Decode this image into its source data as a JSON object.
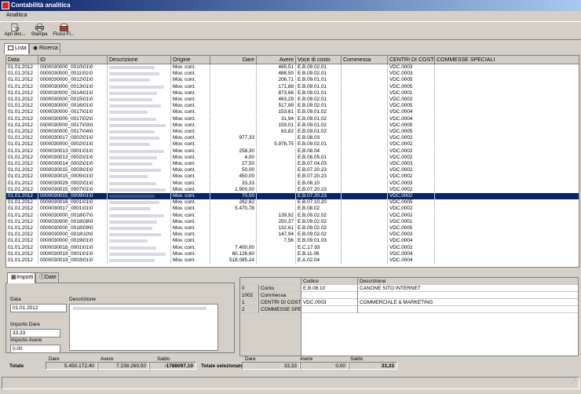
{
  "window": {
    "title": "Contabilità analitica"
  },
  "menu": {
    "items": [
      "Analitica"
    ]
  },
  "toolbar": {
    "buttons": [
      {
        "label": "Apri doc...",
        "icon": "open-document-icon"
      },
      {
        "label": "Stampa",
        "icon": "printer-icon"
      },
      {
        "label": "Flussi Fi...",
        "icon": "flows-icon"
      }
    ]
  },
  "tabs": {
    "lista": "Lista",
    "ricerca": "Ricerca"
  },
  "grid": {
    "headers": {
      "data": "Data",
      "id": "ID",
      "descrizione": "Descrizione",
      "origine": "Origine",
      "dare": "Dare",
      "avere": "Avere",
      "voce": "Voce di costo",
      "commessa": "Commessa",
      "centri": "CENTRI DI COSTO",
      "speciali": "COMMESSE SPECIALI"
    },
    "selected_index": 20,
    "rows": [
      {
        "data": "01.01.2012",
        "id": "0000030000_0010\\01\\0",
        "origine": "Mov. cont.",
        "dare": "",
        "avere": "465,51",
        "voce": "E.B.09.02.01",
        "centri": "VDC.0003"
      },
      {
        "data": "01.01.2012",
        "id": "0000030000_0011\\01\\0",
        "origine": "Mov. cont.",
        "dare": "",
        "avere": "488,50",
        "voce": "E.B.09.02.01",
        "centri": "VDC.0003"
      },
      {
        "data": "01.01.2012",
        "id": "0000030000_0012\\01\\0",
        "origine": "Mov. cont.",
        "dare": "",
        "avere": "206,71",
        "voce": "E.B.09.01.01",
        "centri": "VDC.0005"
      },
      {
        "data": "01.01.2012",
        "id": "0000030000_0013\\01\\0",
        "origine": "Mov. cont.",
        "dare": "",
        "avere": "171,88",
        "voce": "E.B.09.01.01",
        "centri": "VDC.0005"
      },
      {
        "data": "01.01.2012",
        "id": "0000030000_0014\\01\\0",
        "origine": "Mov. cont.",
        "dare": "",
        "avere": "873,66",
        "voce": "E.B.09.01.01",
        "centri": "VDC.0001"
      },
      {
        "data": "01.01.2012",
        "id": "0000030000_0015\\01\\0",
        "origine": "Mov. cont.",
        "dare": "",
        "avere": "463,29",
        "voce": "E.B.09.02.01",
        "centri": "VDC.0002"
      },
      {
        "data": "01.01.2012",
        "id": "0000030000_0016\\01\\0",
        "origine": "Mov. cont.",
        "dare": "",
        "avere": "517,99",
        "voce": "E.B.09.02.01",
        "centri": "VDC.0005"
      },
      {
        "data": "01.01.2012",
        "id": "0000030000_0017\\01\\0",
        "origine": "Mov. cont.",
        "dare": "",
        "avere": "153,61",
        "voce": "E.B.09.01.02",
        "centri": "VDC.0004"
      },
      {
        "data": "01.01.2012",
        "id": "0000030000_0017\\02\\0",
        "origine": "Mov. cont.",
        "dare": "",
        "avere": "31,94",
        "voce": "E.B.09.01.02",
        "centri": "VDC.0004"
      },
      {
        "data": "01.01.2012",
        "id": "0000030000_0017\\03\\0",
        "origine": "Mov. cont.",
        "dare": "",
        "avere": "159,01",
        "voce": "E.B.09.01.02",
        "centri": "VDC.0005"
      },
      {
        "data": "01.01.2012",
        "id": "0000030000_0017\\04\\0",
        "origine": "Mov. cont.",
        "dare": "",
        "avere": "63,82",
        "voce": "E.B.09.01.02",
        "centri": "VDC.0005"
      },
      {
        "data": "01.01.2012",
        "id": "0000030017_0002\\01\\0",
        "origine": "Mov. cont.",
        "dare": "977,33",
        "avere": "",
        "voce": "E.B.08.03",
        "centri": "VDC.0002"
      },
      {
        "data": "01.01.2012",
        "id": "0000030000_0002\\01\\0",
        "origine": "Mov. cont.",
        "dare": "",
        "avere": "5.978,75",
        "voce": "E.B.09.02.01",
        "centri": "VDC.0002"
      },
      {
        "data": "01.01.2012",
        "id": "0000030013_0001\\01\\0",
        "origine": "Mov. cont.",
        "dare": "258,30",
        "avere": "",
        "voce": "E.B.08.04",
        "centri": "VDC.0002"
      },
      {
        "data": "01.01.2012",
        "id": "0000030013_0002\\01\\0",
        "origine": "Mov. cont.",
        "dare": "4,00",
        "avere": "",
        "voce": "E.B.06.05.01",
        "centri": "VDC.0002"
      },
      {
        "data": "01.01.2012",
        "id": "0000030014_0002\\01\\0",
        "origine": "Mov. cont.",
        "dare": "27,50",
        "avere": "",
        "voce": "E.B.07.04.03",
        "centri": "VDC.0003"
      },
      {
        "data": "01.01.2012",
        "id": "0000030015_0003\\01\\0",
        "origine": "Mov. cont.",
        "dare": "50,00",
        "avere": "",
        "voce": "E.B.07.20.23",
        "centri": "VDC.0002"
      },
      {
        "data": "01.01.2012",
        "id": "0000030015_0005\\01\\0",
        "origine": "Mov. cont.",
        "dare": "450,00",
        "avere": "",
        "voce": "E.B.07.20.23",
        "centri": "VDC.0002"
      },
      {
        "data": "01.01.2012",
        "id": "0000030029_0002\\01\\0",
        "origine": "Mov. cont.",
        "dare": "33,33",
        "avere": "",
        "voce": "E.B.08.10",
        "centri": "VDC.0003"
      },
      {
        "data": "01.01.2012",
        "id": "0000030015_0007\\01\\0",
        "origine": "Mov. cont.",
        "dare": "1.900,00",
        "avere": "",
        "voce": "E.B.07.20.23",
        "centri": "VDC.0002"
      },
      {
        "data": "01.01.2012",
        "id": "0000030015_0009\\01\\0",
        "origine": "Mov. cont.",
        "dare": "70,00",
        "avere": "",
        "voce": "E.B.07.20.23",
        "centri": "VDC.0002"
      },
      {
        "data": "01.01.2012",
        "id": "0000030016_0001\\01\\0",
        "origine": "Mov. cont.",
        "dare": "262,62",
        "avere": "",
        "voce": "E.B.07.10.20",
        "centri": "VDC.0005"
      },
      {
        "data": "01.01.2012",
        "id": "0000030017_0001\\01\\0",
        "origine": "Mov. cont.",
        "dare": "5.470,78",
        "avere": "",
        "voce": "E.B.08.02",
        "centri": "VDC.0002"
      },
      {
        "data": "01.01.2012",
        "id": "0000030000_0018\\07\\0",
        "origine": "Mov. cont.",
        "dare": "",
        "avere": "139,92",
        "voce": "E.B.09.02.02",
        "centri": "VDC.0002"
      },
      {
        "data": "01.01.2012",
        "id": "0000030000_0018\\08\\0",
        "origine": "Mov. cont.",
        "dare": "",
        "avere": "250,37",
        "voce": "E.B.09.02.02",
        "centri": "VDC.0001"
      },
      {
        "data": "01.01.2012",
        "id": "0000030000_0018\\09\\0",
        "origine": "Mov. cont.",
        "dare": "",
        "avere": "132,61",
        "voce": "E.B.09.02.02",
        "centri": "VDC.0005"
      },
      {
        "data": "01.01.2012",
        "id": "0000030000_0018\\10\\0",
        "origine": "Mov. cont.",
        "dare": "",
        "avere": "147,94",
        "voce": "E.B.09.02.02",
        "centri": "VDC.0003"
      },
      {
        "data": "01.01.2012",
        "id": "0000030000_0019\\01\\0",
        "origine": "Mov. cont.",
        "dare": "",
        "avere": "7,56",
        "voce": "E.B.09.01.03",
        "centri": "VDC.0004"
      },
      {
        "data": "01.01.2012",
        "id": "0000030018_0001\\01\\0",
        "origine": "Mov. cont.",
        "dare": "7.400,00",
        "avere": "",
        "voce": "E.C.17.93",
        "centri": "VDC.0002"
      },
      {
        "data": "01.01.2012",
        "id": "0000030019_0001\\01\\0",
        "origine": "Mov. cont.",
        "dare": "60.126,60",
        "avere": "",
        "voce": "E.B.11.06",
        "centri": "VDC.0004"
      },
      {
        "data": "01.01.2012",
        "id": "0000030019_0003\\01\\0",
        "origine": "Mov. cont.",
        "dare": "518.085,24",
        "avere": "",
        "voce": "E.A.02.04",
        "centri": "VDC.0004"
      }
    ]
  },
  "detail": {
    "tabs": {
      "importi": "Importi",
      "date": "Date"
    },
    "data_label": "Data",
    "data_value": "01.01.2012",
    "descrizione_label": "Descrizione",
    "importo_dare_label": "Importo Dare",
    "importo_dare_value": "33,33",
    "importo_avere_label": "Importo Avere",
    "importo_avere_value": "0,00"
  },
  "dimensions": {
    "headers": {
      "codice": "Codice",
      "descrizione": "Descrizione"
    },
    "rows": [
      {
        "num": "0",
        "label": "Conto",
        "codice": "E.B.08.10",
        "descrizione": "CANONE SITO INTERNET"
      },
      {
        "num": "1002",
        "label": "Commessa",
        "codice": "",
        "descrizione": ""
      },
      {
        "num": "1",
        "label": "CENTRI DI COSTO",
        "codice": "VDC.0003",
        "descrizione": "COMMERCIALE & MARKETING"
      },
      {
        "num": "2",
        "label": "COMMESSE SPEC",
        "codice": "",
        "descrizione": ""
      }
    ]
  },
  "totals": {
    "totale_label": "Totale",
    "dare_label": "Dare",
    "avere_label": "Avere",
    "saldo_label": "Saldo",
    "dare": "5.450.172,40",
    "avere": "7.238.269,50",
    "saldo": "-1788097,10",
    "selezionato_label": "Totale selezionato",
    "sel_dare": "33,33",
    "sel_avere": "0,00",
    "sel_saldo": "33,33"
  }
}
